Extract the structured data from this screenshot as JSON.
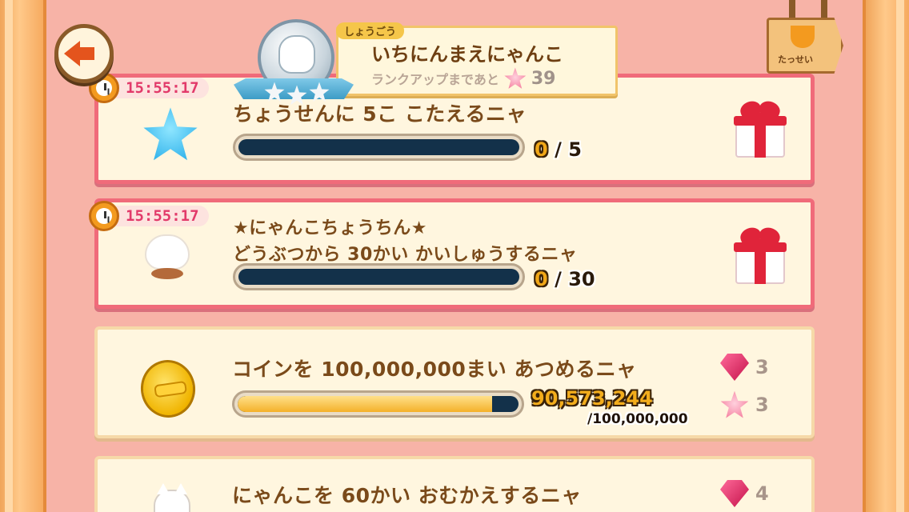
{
  "header": {
    "title_tag": "しょうごう",
    "title_name": "いちにんまえにゃんこ",
    "rankup_text": "ランクアップまであと",
    "rankup_count": "39",
    "achievements_label": "たっせい"
  },
  "quests": [
    {
      "timer": "15:55:17",
      "title": "ちょうせんに 5こ こたえるニャ",
      "progress_current": "0",
      "progress_sep": "/",
      "progress_total": "5",
      "progress_fraction": 0.0,
      "icon": "blue-star-icon",
      "reward_icon": "gift-icon"
    },
    {
      "timer": "15:55:17",
      "title_line1": "★にゃんこちょうちん★",
      "title_line2": "どうぶつから 30かい かいしゅうするニャ",
      "progress_current": "0",
      "progress_sep": "/",
      "progress_total": "30",
      "progress_fraction": 0.0,
      "icon": "nyanko-lantern-icon",
      "reward_icon": "gift-icon"
    },
    {
      "title": "コインを 100,000,000まい あつめるニャ",
      "progress_current": "90,573,244",
      "progress_total": "/100,000,000",
      "progress_fraction": 0.9057,
      "icon": "coin-icon",
      "rewards": [
        {
          "icon": "gem-icon",
          "amount": "3"
        },
        {
          "icon": "pink-star-icon",
          "amount": "3"
        }
      ]
    },
    {
      "title": "にゃんこを 60かい おむかえするニャ",
      "icon": "cat-icon",
      "rewards": [
        {
          "icon": "gem-icon",
          "amount": "4"
        }
      ]
    }
  ],
  "colors": {
    "frame": "#f6aa5f",
    "background": "#f7b3a7",
    "timed_border": "#f06b7a",
    "text_brown": "#7a4a1a",
    "timer_red": "#e23a6a"
  }
}
